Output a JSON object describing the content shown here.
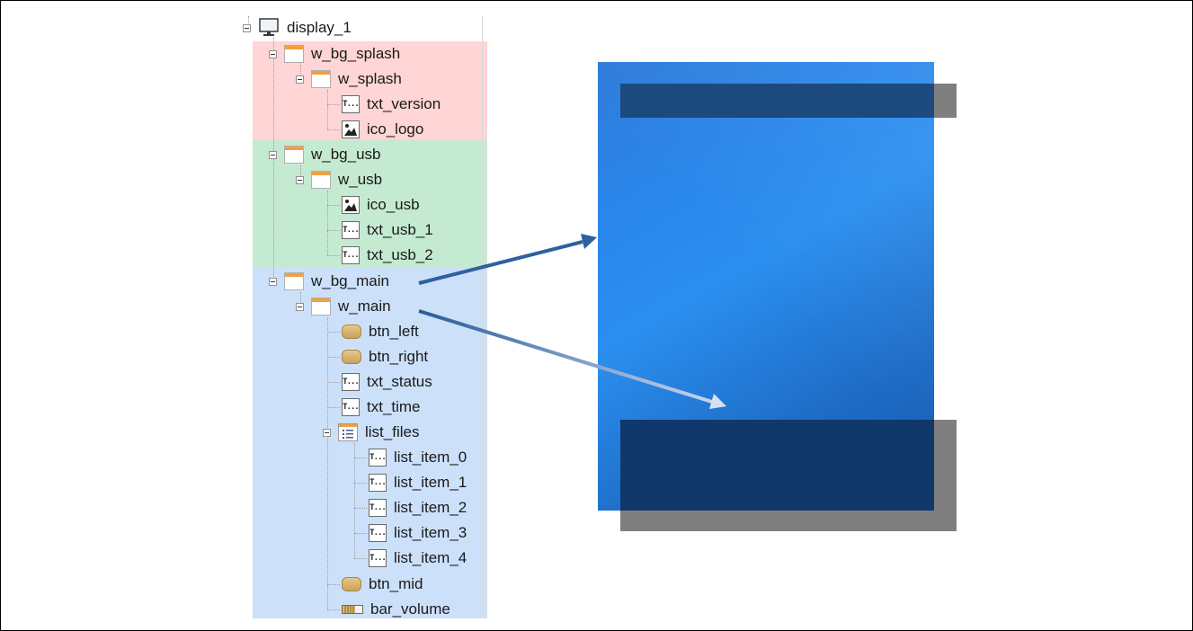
{
  "tree": {
    "root": {
      "label": "display_1",
      "icon": "display-icon"
    },
    "nodes": [
      {
        "label": "w_bg_splash",
        "icon": "window-icon"
      },
      {
        "label": "w_splash",
        "icon": "window-icon"
      },
      {
        "label": "txt_version",
        "icon": "text-icon"
      },
      {
        "label": "ico_logo",
        "icon": "image-icon"
      },
      {
        "label": "w_bg_usb",
        "icon": "window-icon"
      },
      {
        "label": "w_usb",
        "icon": "window-icon"
      },
      {
        "label": "ico_usb",
        "icon": "image-icon"
      },
      {
        "label": "txt_usb_1",
        "icon": "text-icon"
      },
      {
        "label": "txt_usb_2",
        "icon": "text-icon"
      },
      {
        "label": "w_bg_main",
        "icon": "window-icon"
      },
      {
        "label": "w_main",
        "icon": "window-icon"
      },
      {
        "label": "btn_left",
        "icon": "button-icon"
      },
      {
        "label": "btn_right",
        "icon": "button-icon"
      },
      {
        "label": "txt_status",
        "icon": "text-icon"
      },
      {
        "label": "txt_time",
        "icon": "text-icon"
      },
      {
        "label": "list_files",
        "icon": "list-icon"
      },
      {
        "label": "list_item_0",
        "icon": "text-icon"
      },
      {
        "label": "list_item_1",
        "icon": "text-icon"
      },
      {
        "label": "list_item_2",
        "icon": "text-icon"
      },
      {
        "label": "list_item_3",
        "icon": "text-icon"
      },
      {
        "label": "list_item_4",
        "icon": "text-icon"
      },
      {
        "label": "btn_mid",
        "icon": "button-icon"
      },
      {
        "label": "bar_volume",
        "icon": "progress-bar-icon"
      }
    ],
    "text_icon_glyph": "T...",
    "group_colors": {
      "splash": "#ffd5d5",
      "usb": "#c4ead1",
      "main": "#cce0fa"
    }
  },
  "screen": {
    "background_color": "#2b8ff0",
    "bar_color": "#10386b",
    "shadow_color": "#7f7f7f"
  }
}
